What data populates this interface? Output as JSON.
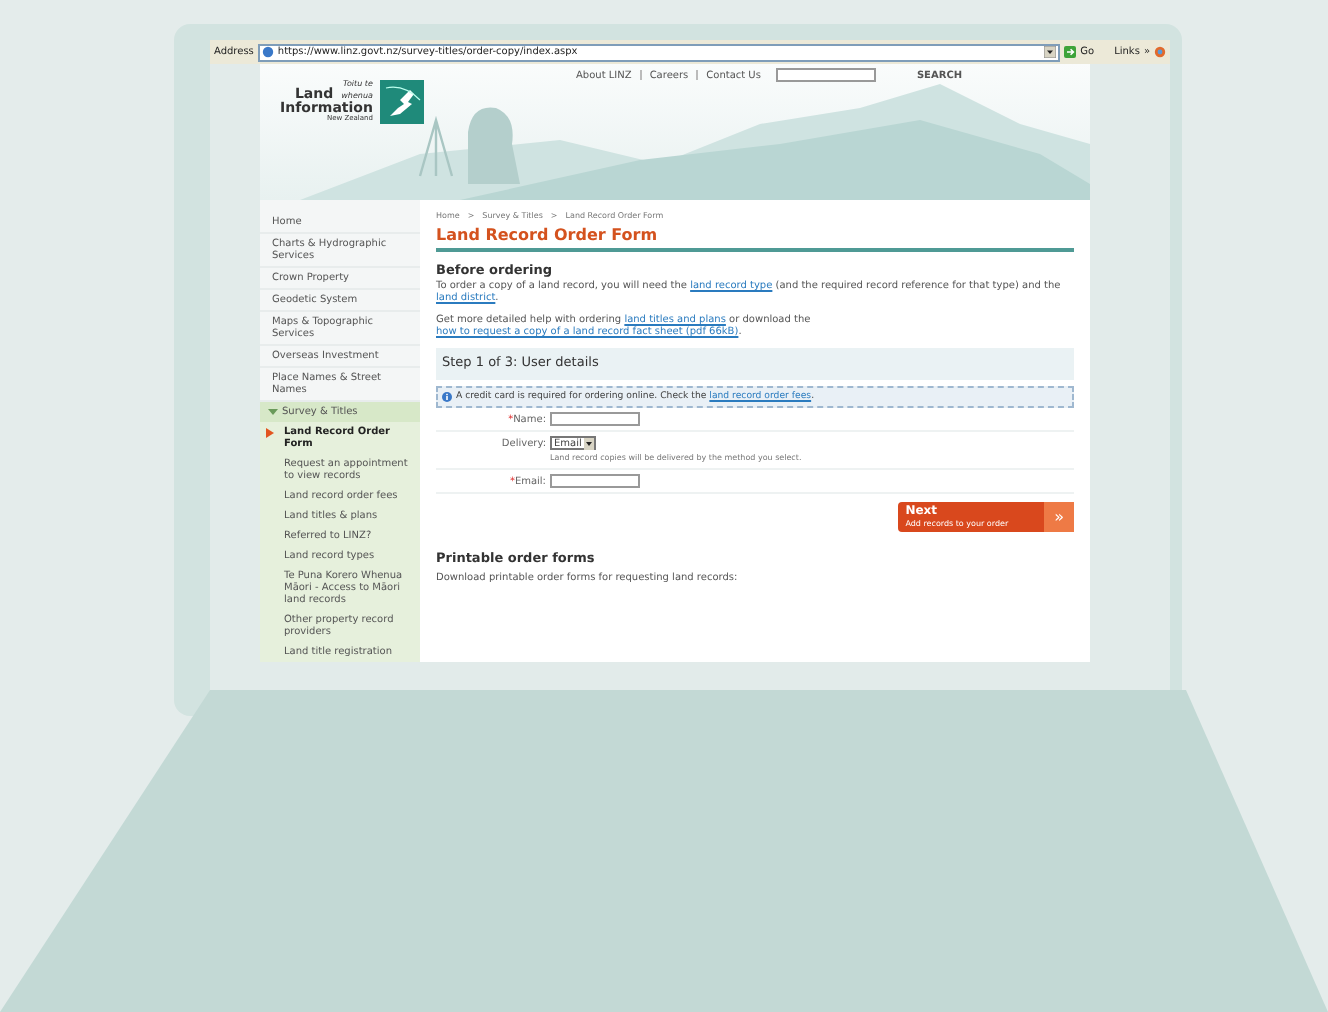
{
  "browser": {
    "address_label": "Address",
    "url": "https://www.linz.govt.nz/survey-titles/order-copy/index.aspx",
    "go": "Go",
    "links": "Links",
    "more": "»"
  },
  "header": {
    "top_links": [
      "About LINZ",
      "Careers",
      "Contact Us"
    ],
    "search_button": "SEARCH",
    "logo": {
      "line_1": "Toitu te",
      "land": "Land",
      "whenua": "whenua",
      "information": "Information",
      "country": "New Zealand"
    }
  },
  "sidebar": {
    "items": [
      {
        "label": "Home",
        "kind": "link"
      },
      {
        "label": "Charts & Hydrographic Services",
        "kind": "link"
      },
      {
        "label": "Crown Property",
        "kind": "link"
      },
      {
        "label": "Geodetic System",
        "kind": "link"
      },
      {
        "label": "Maps & Topographic Services",
        "kind": "link"
      },
      {
        "label": "Overseas Investment",
        "kind": "link"
      },
      {
        "label": "Place Names & Street Names",
        "kind": "link"
      },
      {
        "label": "Survey & Titles",
        "kind": "section",
        "expanded": true,
        "children": [
          {
            "label": "Land Record Order Form",
            "selected": true
          },
          {
            "label": "Request an appointment to view records",
            "selected": false
          },
          {
            "label": "Land record order fees",
            "selected": false
          },
          {
            "label": "Land titles & plans",
            "selected": false
          },
          {
            "label": "Referred to LINZ?",
            "selected": false
          },
          {
            "label": "Land record types",
            "selected": false
          },
          {
            "label": "Te Puna Korero Whenua Māori - Access to Māori land records",
            "selected": false
          },
          {
            "label": "Other property record providers",
            "selected": false
          },
          {
            "label": "Land title registration",
            "selected": false
          }
        ]
      }
    ]
  },
  "breadcrumb": [
    "Home",
    "Survey & Titles",
    "Land Record Order Form"
  ],
  "breadcrumb_separator": ">",
  "title": "Land Record Order Form",
  "before": {
    "heading": "Before ordering",
    "paragraphs": [
      [
        {
          "text": "To order a copy of a land record, you will need the ",
          "link": false
        },
        {
          "text": "land record type",
          "link": true
        },
        {
          "text": " (and the required record reference for that type) and the ",
          "link": false
        },
        {
          "text": "land district",
          "link": true
        },
        {
          "text": ".",
          "link": false
        }
      ],
      [
        {
          "text": "Get more detailed help with ordering ",
          "link": false
        },
        {
          "text": "land titles and plans",
          "link": true
        },
        {
          "text": " or download the ",
          "link": false
        },
        {
          "text": "how to request a copy of a land record fact sheet (pdf 66kB)",
          "link": true
        },
        {
          "text": ".",
          "link": false
        }
      ]
    ]
  },
  "step": {
    "heading": "Step 1 of 3: User details",
    "notice": [
      {
        "text": "A credit card is required for ordering online. Check the ",
        "link": false
      },
      {
        "text": "land record order fees",
        "link": true
      },
      {
        "text": ".",
        "link": false
      }
    ]
  },
  "form": [
    {
      "label": "Name:",
      "kind": "text",
      "required": true
    },
    {
      "label": "Delivery:",
      "kind": "select",
      "required": false,
      "value": "Email",
      "help": "Land record copies will be delivered by the method you select."
    },
    {
      "label": "Email:",
      "kind": "text",
      "required": true
    }
  ],
  "required_mark": "*",
  "next_button": {
    "label": "Next",
    "sub": "Add records to your order",
    "arrow": "»"
  },
  "printable": {
    "heading": "Printable order forms",
    "text": "Download printable order forms for requesting land records:"
  }
}
